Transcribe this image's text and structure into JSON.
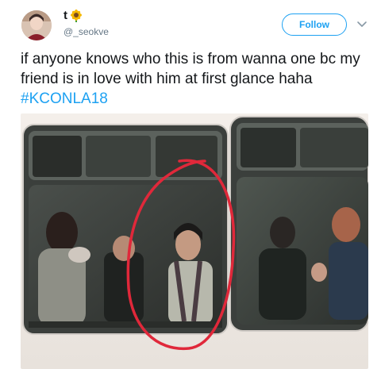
{
  "user": {
    "display_name": "t",
    "name_emoji": "sunflower-emoji",
    "handle": "@_seokve"
  },
  "actions": {
    "follow_label": "Follow",
    "menu_icon": "chevron-down-icon"
  },
  "tweet": {
    "text": "if anyone knows who this is from wanna one bc my friend is in love with him at first glance haha ",
    "hashtag": "#KCONLA18"
  },
  "media": {
    "description_icon": "photo",
    "accent_colors": {
      "link": "#1da1f2",
      "circle": "#e0283a",
      "bus_frame": "#2b2b2b"
    }
  }
}
